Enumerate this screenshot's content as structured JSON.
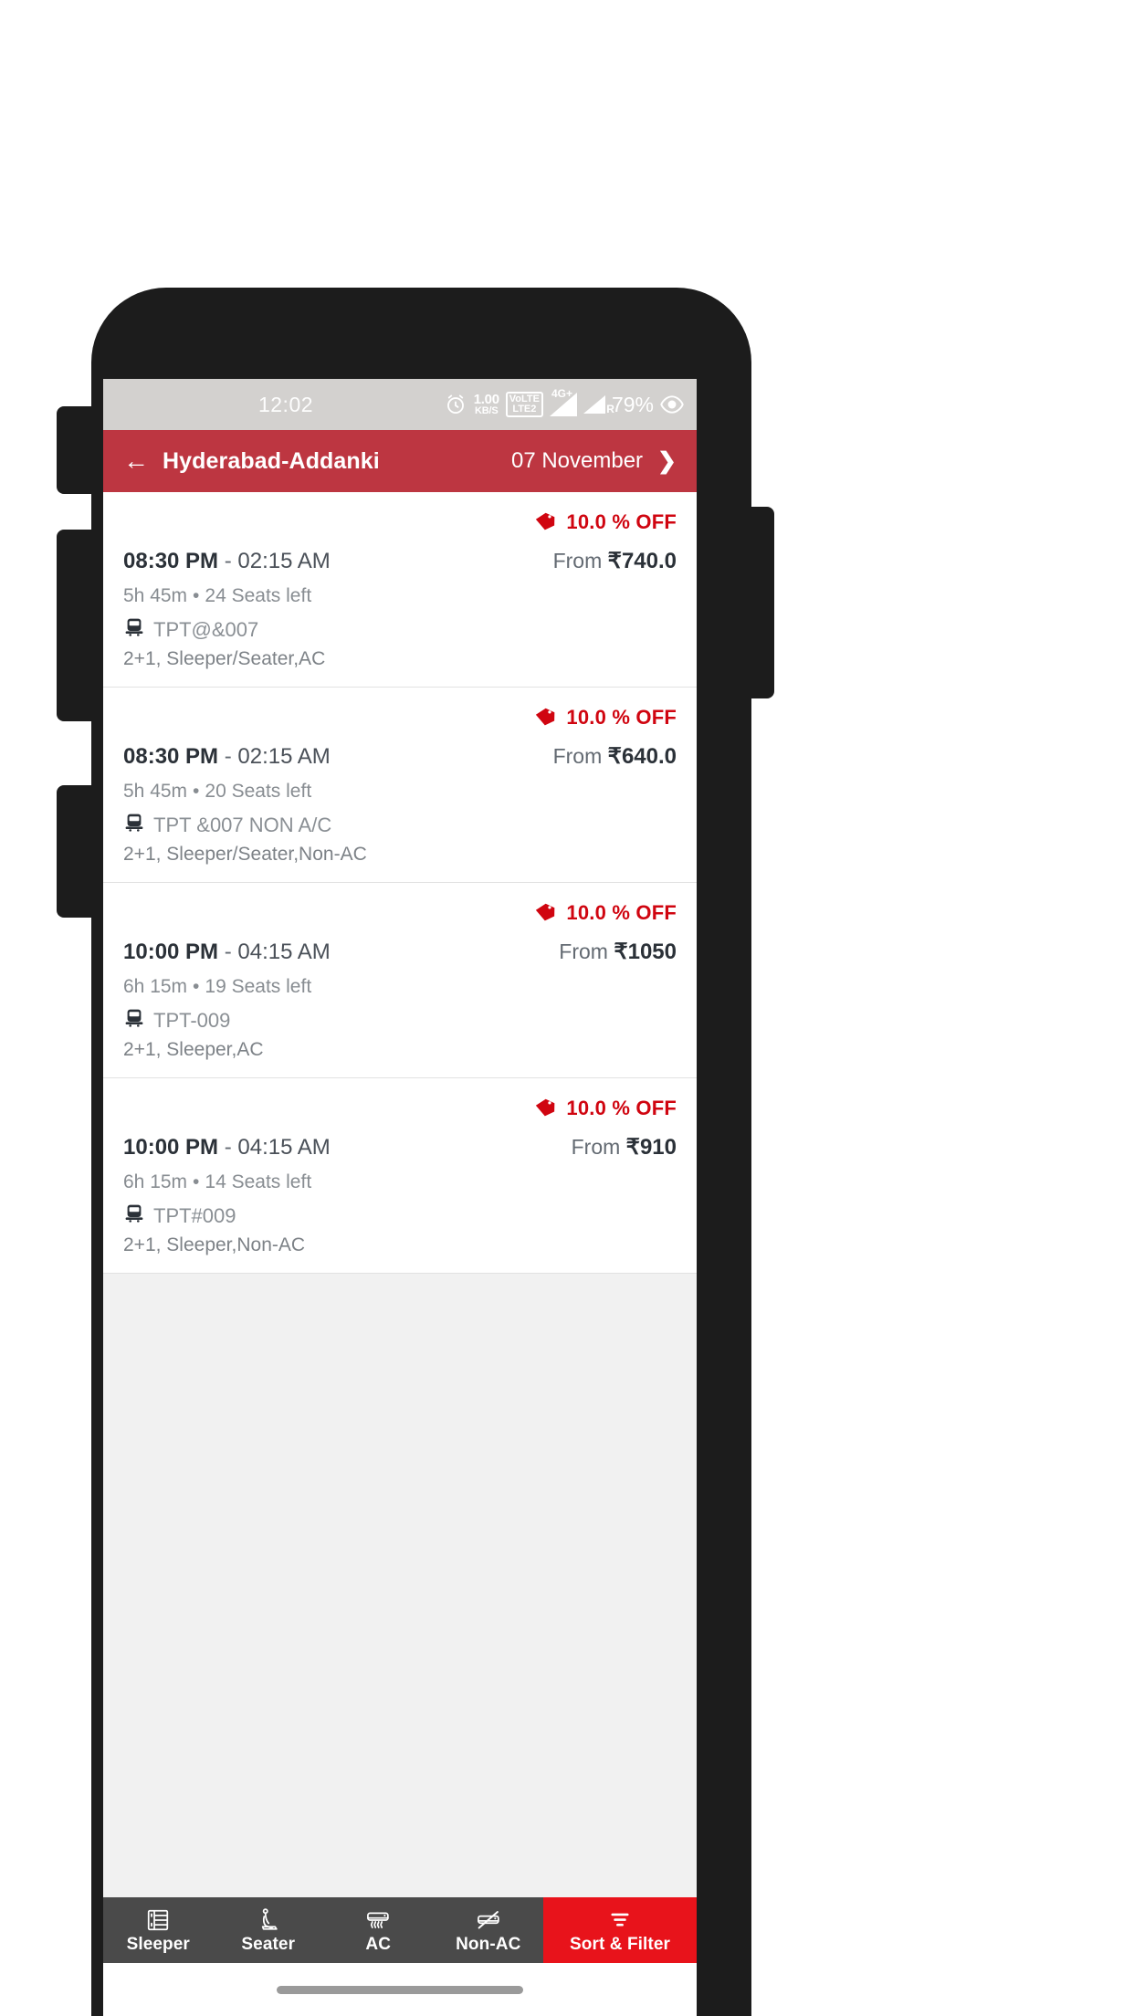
{
  "status_bar": {
    "time": "12:02",
    "alarm_icon": "alarm-clock-icon",
    "net_speed_value": "1.00",
    "net_speed_unit": "KB/S",
    "volte_line1": "VoLTE",
    "volte_line2": "LTE2",
    "signal1_tag": "4G+",
    "signal2_tag": "R",
    "battery": "79%",
    "eye_icon": "eye-protect-icon",
    "background": "#d3d1cf"
  },
  "header": {
    "back_icon": "back-arrow-icon",
    "route": "Hyderabad-Addanki",
    "date": "07 November",
    "forward_icon": "chevron-right-icon",
    "background": "#bd3641"
  },
  "results": [
    {
      "discount": "10.0 % OFF",
      "discount_icon": "price-tag-icon",
      "departure": "08:30 PM",
      "separator": " - ",
      "arrival": "02:15 AM",
      "duration": "5h 45m",
      "bullet": "•",
      "seats": "24 Seats left",
      "bus_icon": "bus-icon",
      "bus_name": "TPT@&007",
      "configuration": "2+1, Sleeper/Seater,AC",
      "price_prefix": "From",
      "price_currency": "₹",
      "price_amount": "740.0"
    },
    {
      "discount": "10.0 % OFF",
      "discount_icon": "price-tag-icon",
      "departure": "08:30 PM",
      "separator": " - ",
      "arrival": "02:15 AM",
      "duration": "5h 45m",
      "bullet": "•",
      "seats": "20 Seats left",
      "bus_icon": "bus-icon",
      "bus_name": "TPT &007 NON A/C",
      "configuration": "2+1, Sleeper/Seater,Non-AC",
      "price_prefix": "From",
      "price_currency": "₹",
      "price_amount": "640.0"
    },
    {
      "discount": "10.0 % OFF",
      "discount_icon": "price-tag-icon",
      "departure": "10:00 PM",
      "separator": " - ",
      "arrival": "04:15 AM",
      "duration": "6h 15m",
      "bullet": "•",
      "seats": "19 Seats left",
      "bus_icon": "bus-icon",
      "bus_name": "TPT-009",
      "configuration": "2+1, Sleeper,AC",
      "price_prefix": "From",
      "price_currency": "₹",
      "price_amount": "1050"
    },
    {
      "discount": "10.0 % OFF",
      "discount_icon": "price-tag-icon",
      "departure": "10:00 PM",
      "separator": " - ",
      "arrival": "04:15 AM",
      "duration": "6h 15m",
      "bullet": "•",
      "seats": "14 Seats left",
      "bus_icon": "bus-icon",
      "bus_name": "TPT#009",
      "configuration": "2+1, Sleeper,Non-AC",
      "price_prefix": "From",
      "price_currency": "₹",
      "price_amount": "910"
    }
  ],
  "bottom_bar": {
    "items": [
      {
        "label": "Sleeper",
        "icon": "sleeper-berth-icon"
      },
      {
        "label": "Seater",
        "icon": "seat-icon"
      },
      {
        "label": "AC",
        "icon": "air-conditioner-icon"
      },
      {
        "label": "Non-AC",
        "icon": "air-conditioner-off-icon"
      },
      {
        "label": "Sort & Filter",
        "icon": "filter-icon"
      }
    ],
    "accent_color": "#e8131b",
    "background": "#4a4a4a"
  },
  "colors": {
    "brand_red": "#bd3641",
    "discount_red": "#d00510",
    "filter_red": "#e8131b",
    "list_background": "#f1f1f1"
  }
}
